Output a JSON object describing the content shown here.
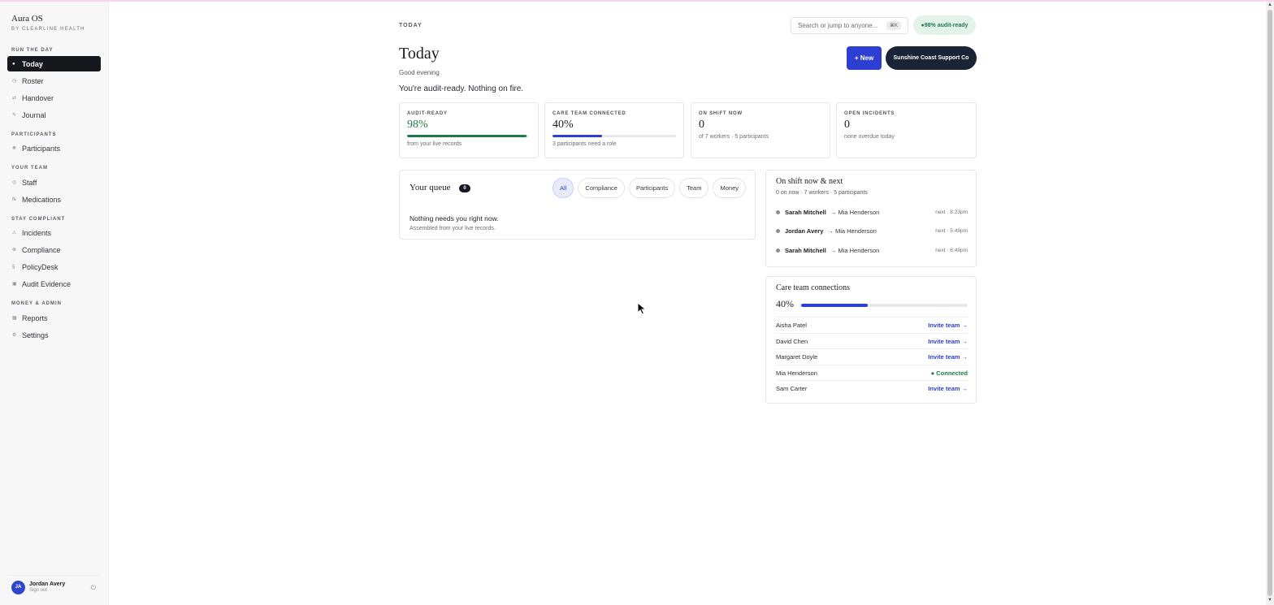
{
  "app": {
    "brand": "Aura OS",
    "brand_sub": "BY CLEARLINE HEALTH"
  },
  "sidebar": {
    "sections": [
      {
        "title": "RUN THE DAY"
      },
      {
        "title": "PARTICIPANTS"
      },
      {
        "title": "YOUR TEAM"
      },
      {
        "title": "STAY COMPLIANT"
      },
      {
        "title": "MONEY & ADMIN"
      }
    ],
    "items": [
      {
        "label": "Today",
        "icon": "●"
      },
      {
        "label": "Roster",
        "icon": "◷"
      },
      {
        "label": "Handover",
        "icon": "⇄"
      },
      {
        "label": "Journal",
        "icon": "✎"
      },
      {
        "label": "Participants",
        "icon": "❋"
      },
      {
        "label": "Staff",
        "icon": "◎"
      },
      {
        "label": "Medications",
        "icon": "℞"
      },
      {
        "label": "Incidents",
        "icon": "⚠"
      },
      {
        "label": "Compliance",
        "icon": "⊗"
      },
      {
        "label": "PolicyDesk",
        "icon": "§"
      },
      {
        "label": "Audit Evidence",
        "icon": "▣"
      },
      {
        "label": "Reports",
        "icon": "▦"
      },
      {
        "label": "Settings",
        "icon": "⚙"
      }
    ]
  },
  "user": {
    "initials": "JA",
    "name": "Jordan Avery",
    "sub": "Sign out"
  },
  "header": {
    "crumb": "TODAY",
    "search_placeholder": "Search or jump to anyone...",
    "search_shortcut": "⌘K",
    "audit_pill": "●98% audit-ready",
    "title": "Today",
    "greeting": "Good evening",
    "status": "You're audit-ready. Nothing on fire.",
    "new_button": "+ New",
    "org_button": "Sunshine Coast Support Co"
  },
  "stats": [
    {
      "label": "AUDIT-READY",
      "value": "98%",
      "note": "from your live records",
      "progress": 0.98,
      "color": "#1e7b45"
    },
    {
      "label": "CARE TEAM CONNECTED",
      "value": "40%",
      "note": "3 participants need a role",
      "progress": 0.4,
      "color": "#2d3fd3"
    },
    {
      "label": "ON SHIFT NOW",
      "value": "0",
      "note": "of 7 workers · 5 participants"
    },
    {
      "label": "OPEN INCIDENTS",
      "value": "0",
      "note": "none overdue today"
    }
  ],
  "queue": {
    "title": "Your queue",
    "count": "0",
    "filters": [
      "All",
      "Compliance",
      "Participants",
      "Team",
      "Money"
    ],
    "empty": "Nothing needs you right now.",
    "empty_sub": "Assembled from your live records."
  },
  "shift": {
    "title": "On shift now & next",
    "sub": "0 on now · 7 workers · 5 participants",
    "rows": [
      {
        "worker": "Sarah Mitchell",
        "participant": "→ Mia Henderson",
        "next": "next · 8:23pm"
      },
      {
        "worker": "Jordan Avery",
        "participant": "→ Mia Henderson",
        "next": "next · 5:49pm"
      },
      {
        "worker": "Sarah Mitchell",
        "participant": "→ Mia Henderson",
        "next": "next · 6:49pm"
      }
    ]
  },
  "care_team": {
    "title": "Care team connections",
    "percent": "40%",
    "progress": 0.4,
    "rows": [
      {
        "name": "Aisha Patel",
        "action": "Invite team →",
        "state": "invite"
      },
      {
        "name": "David Chen",
        "action": "Invite team →",
        "state": "invite"
      },
      {
        "name": "Margaret Doyle",
        "action": "Invite team →",
        "state": "invite"
      },
      {
        "name": "Mia Henderson",
        "action": "● Connected",
        "state": "connected"
      },
      {
        "name": "Sam Carter",
        "action": "Invite team →",
        "state": "invite"
      }
    ]
  }
}
